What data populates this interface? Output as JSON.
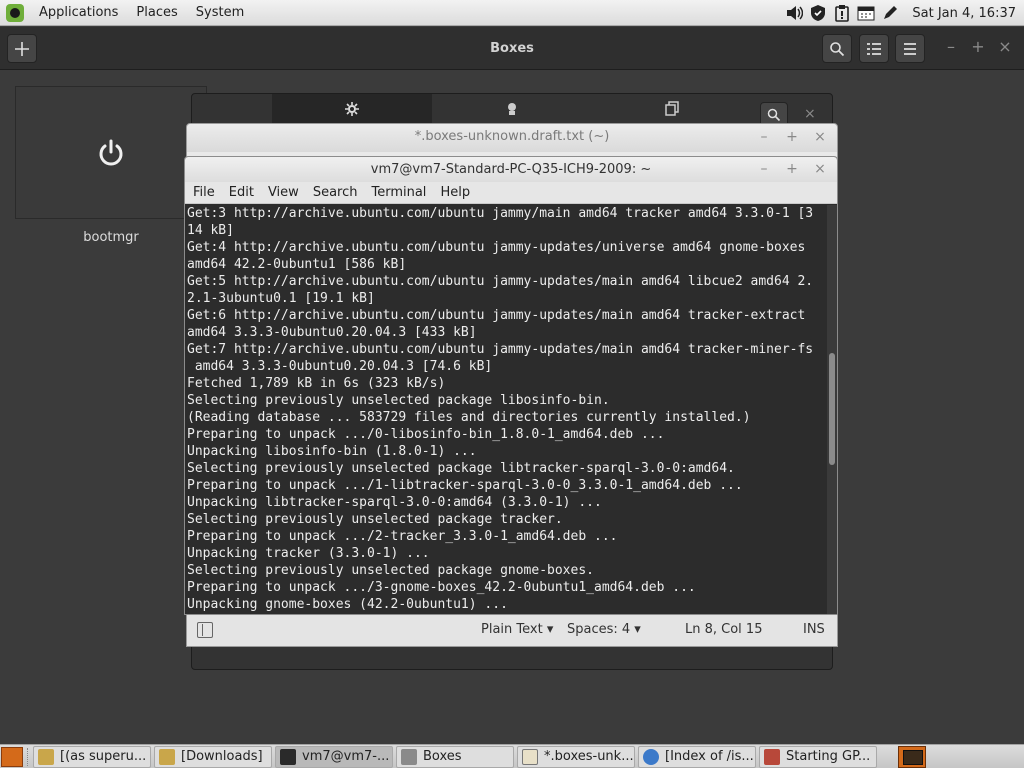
{
  "top_panel": {
    "menu": [
      "Applications",
      "Places",
      "System"
    ],
    "clock": "Sat Jan  4, 16:37",
    "tray_icons": [
      "volume-icon",
      "shield-icon",
      "clipboard-icon",
      "calendar-icon",
      "pen-icon"
    ]
  },
  "boxes": {
    "title": "Boxes",
    "vm_label": "bootmgr",
    "wm_controls": [
      "–",
      "+",
      "×"
    ]
  },
  "props_dialog": {
    "tabs": [
      "gear-icon",
      "cpu-icon",
      "copy-icon"
    ],
    "close": "×"
  },
  "gedit": {
    "title": "*.boxes-unknown.draft.txt (~)",
    "language": "Plain Text",
    "spaces": "Spaces: 4",
    "position": "Ln 8, Col 15",
    "mode": "INS"
  },
  "terminal": {
    "title": "vm7@vm7-Standard-PC-Q35-ICH9-2009: ~",
    "menu": [
      "File",
      "Edit",
      "View",
      "Search",
      "Terminal",
      "Help"
    ],
    "output": "Get:3 http://archive.ubuntu.com/ubuntu jammy/main amd64 tracker amd64 3.3.0-1 [3\n14 kB]\nGet:4 http://archive.ubuntu.com/ubuntu jammy-updates/universe amd64 gnome-boxes\namd64 42.2-0ubuntu1 [586 kB]\nGet:5 http://archive.ubuntu.com/ubuntu jammy-updates/main amd64 libcue2 amd64 2.\n2.1-3ubuntu0.1 [19.1 kB]\nGet:6 http://archive.ubuntu.com/ubuntu jammy-updates/main amd64 tracker-extract\namd64 3.3.3-0ubuntu0.20.04.3 [433 kB]\nGet:7 http://archive.ubuntu.com/ubuntu jammy-updates/main amd64 tracker-miner-fs\n amd64 3.3.3-0ubuntu0.20.04.3 [74.6 kB]\nFetched 1,789 kB in 6s (323 kB/s)\nSelecting previously unselected package libosinfo-bin.\n(Reading database ... 583729 files and directories currently installed.)\nPreparing to unpack .../0-libosinfo-bin_1.8.0-1_amd64.deb ...\nUnpacking libosinfo-bin (1.8.0-1) ...\nSelecting previously unselected package libtracker-sparql-3.0-0:amd64.\nPreparing to unpack .../1-libtracker-sparql-3.0-0_3.3.0-1_amd64.deb ...\nUnpacking libtracker-sparql-3.0-0:amd64 (3.3.0-1) ...\nSelecting previously unselected package tracker.\nPreparing to unpack .../2-tracker_3.3.0-1_amd64.deb ...\nUnpacking tracker (3.3.0-1) ...\nSelecting previously unselected package gnome-boxes.\nPreparing to unpack .../3-gnome-boxes_42.2-0ubuntu1_amd64.deb ...\nUnpacking gnome-boxes (42.2-0ubuntu1) ..."
  },
  "taskbar": {
    "tasks": [
      {
        "label": "[(as superu...",
        "icon": "folder-icon",
        "color": "#c9a64a"
      },
      {
        "label": "[Downloads]",
        "icon": "folder-icon",
        "color": "#c9a64a"
      },
      {
        "label": "vm7@vm7-...",
        "icon": "terminal-icon",
        "color": "#2a2a2a"
      },
      {
        "label": "Boxes",
        "icon": "boxes-icon",
        "color": "#8a8a8a"
      },
      {
        "label": "*.boxes-unk...",
        "icon": "text-editor-icon",
        "color": "#e8e0c8"
      },
      {
        "label": "[Index of /is...",
        "icon": "browser-icon",
        "color": "#3b79c9"
      },
      {
        "label": "Starting GP...",
        "icon": "app-icon",
        "color": "#b8483a"
      }
    ]
  }
}
